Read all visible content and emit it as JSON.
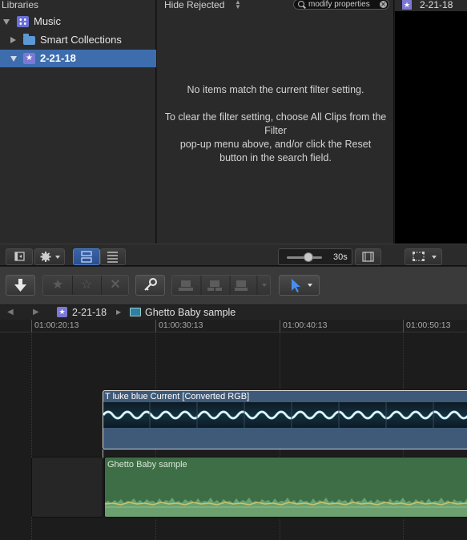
{
  "libraries": {
    "header": "Libraries",
    "items": [
      {
        "label": "Music",
        "icon": "library-icon",
        "expanded": true,
        "selected": false
      },
      {
        "label": "Smart Collections",
        "icon": "folder-icon",
        "expanded": false,
        "selected": false
      },
      {
        "label": "2-21-18",
        "icon": "event-star-icon",
        "expanded": true,
        "selected": true
      }
    ]
  },
  "browser": {
    "filter_label": "Hide Rejected",
    "search_value": "modify properties",
    "empty_line1": "No items match the current filter setting.",
    "empty_line2": "To clear the filter setting, choose All Clips from the Filter",
    "empty_line3": "pop-up menu above, and/or click the Reset",
    "empty_line4": "button in the search field.",
    "zoom_value": "30s"
  },
  "viewer": {
    "title": "2-21-18"
  },
  "timeline": {
    "breadcrumb_event": "2-21-18",
    "breadcrumb_project": "Ghetto Baby sample",
    "ruler": [
      "01:00:20:13",
      "01:00:30:13",
      "01:00:40:13",
      "01:00:50:13"
    ],
    "video_clip_title": "T luke blue Current [Converted RGB]",
    "audio_clip_title": "Ghetto Baby sample"
  },
  "colors": {
    "selection": "#3e6dae",
    "video_clip": "#3f5a78",
    "audio_clip": "#3e6e46",
    "accent_blue": "#4a8cf0"
  }
}
